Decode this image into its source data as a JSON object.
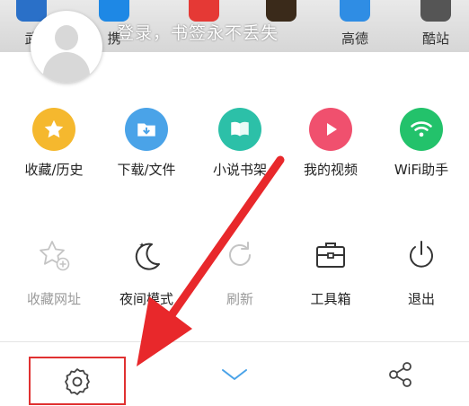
{
  "home": {
    "apps": [
      {
        "label": "武",
        "color": "#2a70c8"
      },
      {
        "label": "携",
        "color": "#1e88e5"
      },
      {
        "label": "",
        "color": "#e53935"
      },
      {
        "label": "",
        "color": "#3a2a1a"
      },
      {
        "label": "高德",
        "color": "#2f8de4"
      },
      {
        "label": "酷站",
        "color": "#555555"
      }
    ]
  },
  "account": {
    "login_text": "登录，书签永不丢失"
  },
  "menu": {
    "row1": [
      {
        "label": "收藏/历史",
        "icon": "star-icon",
        "color": "#f5b82e"
      },
      {
        "label": "下载/文件",
        "icon": "download-folder-icon",
        "color": "#4aa3e8"
      },
      {
        "label": "小说书架",
        "icon": "book-icon",
        "color": "#2cc0a8"
      },
      {
        "label": "我的视频",
        "icon": "play-icon",
        "color": "#f0506e"
      },
      {
        "label": "WiFi助手",
        "icon": "wifi-icon",
        "color": "#23c26b"
      }
    ],
    "row2": [
      {
        "label": "收藏网址",
        "icon": "star-add-icon",
        "enabled": false
      },
      {
        "label": "夜间模式",
        "icon": "moon-icon",
        "enabled": true
      },
      {
        "label": "刷新",
        "icon": "refresh-icon",
        "enabled": false
      },
      {
        "label": "工具箱",
        "icon": "toolbox-icon",
        "enabled": true
      },
      {
        "label": "退出",
        "icon": "power-icon",
        "enabled": true
      }
    ]
  },
  "bottom": {
    "icons": [
      "gear-icon",
      "chevron-down-icon",
      "share-icon"
    ]
  },
  "colors": {
    "highlight": "#e03131",
    "arrow": "#e8282b"
  }
}
